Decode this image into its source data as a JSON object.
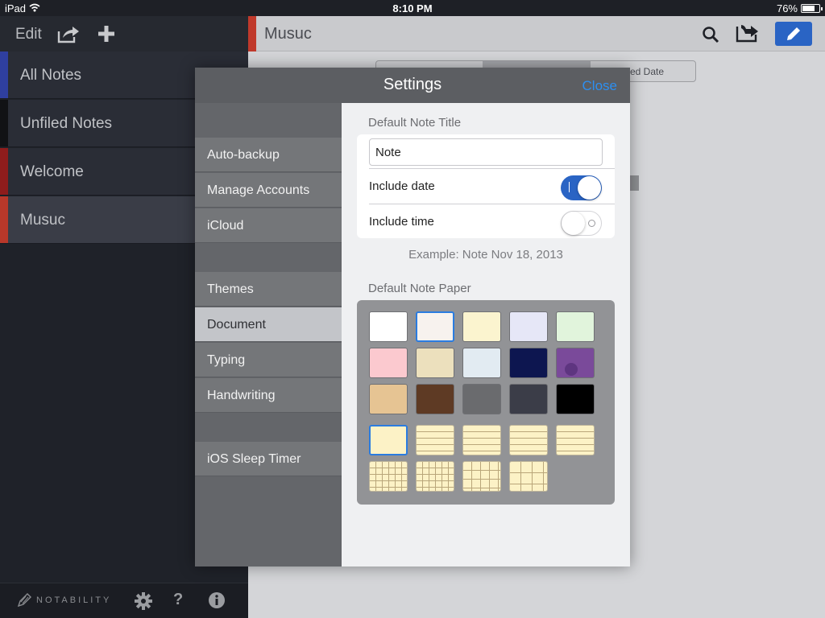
{
  "status_bar": {
    "device": "iPad",
    "time": "8:10 PM",
    "battery_text": "76%",
    "battery_level": 0.76
  },
  "sidebar": {
    "edit_label": "Edit",
    "subjects": [
      {
        "label": "All Notes",
        "color": "#2f3fa0"
      },
      {
        "label": "Unfiled Notes",
        "color": "#111215"
      },
      {
        "label": "Welcome",
        "color": "#8e1c1c"
      },
      {
        "label": "Musuc",
        "color": "#b8382a"
      }
    ],
    "brand": "NOTABILITY"
  },
  "main": {
    "title": "Musuc",
    "sort_right_label": "ated Date"
  },
  "settings": {
    "title": "Settings",
    "close_label": "Close",
    "menu": [
      {
        "label": "Auto-backup"
      },
      {
        "label": "Manage Accounts"
      },
      {
        "label": "iCloud"
      },
      {
        "label": "Themes"
      },
      {
        "label": "Document"
      },
      {
        "label": "Typing"
      },
      {
        "label": "Handwriting"
      },
      {
        "label": "iOS Sleep Timer"
      }
    ],
    "selected_menu": "Document",
    "default_note_title_label": "Default Note Title",
    "default_note_title_value": "Note",
    "include_date_label": "Include date",
    "include_date_on": true,
    "include_time_label": "Include time",
    "include_time_on": false,
    "example_text": "Example: Note Nov 18, 2013",
    "default_note_paper_label": "Default Note Paper",
    "paper_colors": [
      "#ffffff",
      "#f7f2ee",
      "#fbf4cf",
      "#e6e7f7",
      "#e1f4dc",
      "#fbc9cf",
      "#ece0bd",
      "#e2ebf2",
      "#0d1650",
      "#7a4a9a",
      "#e6c493",
      "#5e3a24",
      "#6a6b6e",
      "#3b3d48",
      "#000000"
    ],
    "paper_selected_index": 1,
    "line_paper_selected_index": 0,
    "paper_line_styles": [
      "plain",
      "lined",
      "lined",
      "lined",
      "lined",
      "grid",
      "grid",
      "grid",
      "grid"
    ]
  }
}
